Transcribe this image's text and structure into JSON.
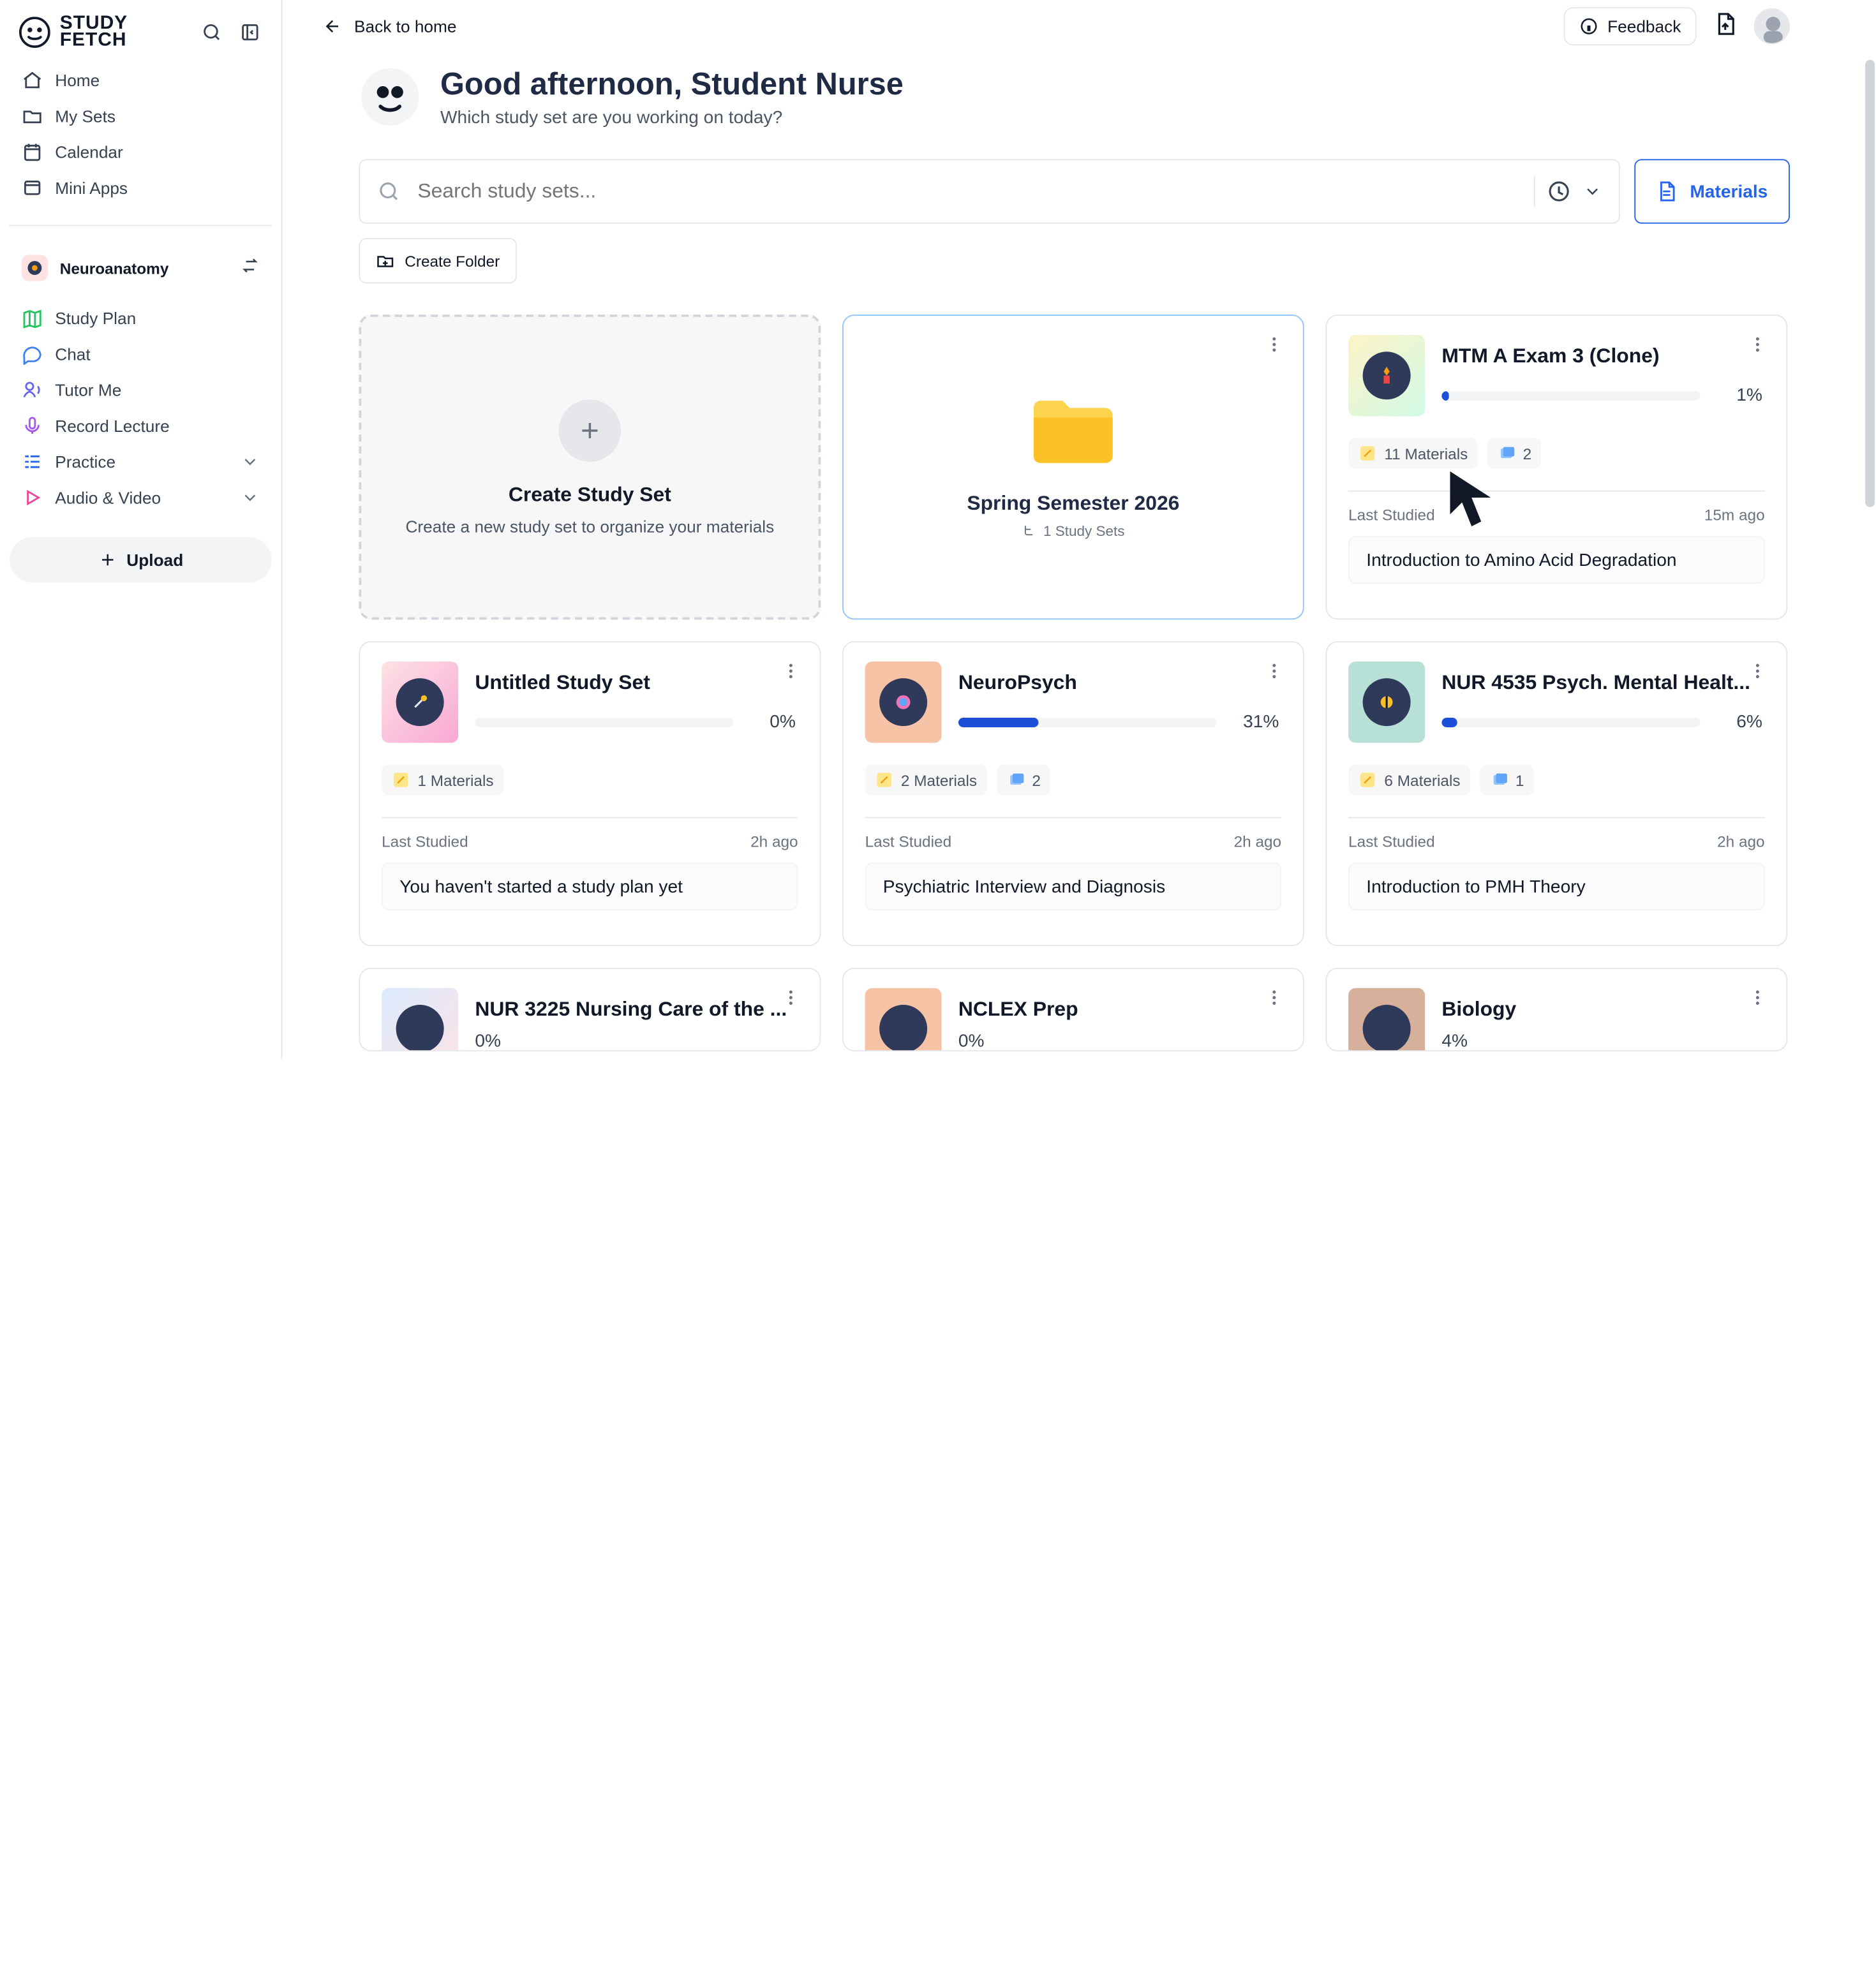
{
  "sidebar": {
    "brand_line1": "STUDY",
    "brand_line2": "FETCH",
    "nav": [
      {
        "label": "Home",
        "icon": "home-icon"
      },
      {
        "label": "My Sets",
        "icon": "folder-icon"
      },
      {
        "label": "Calendar",
        "icon": "calendar-icon"
      },
      {
        "label": "Mini Apps",
        "icon": "mini-apps-icon"
      }
    ],
    "subject": {
      "name": "Neuroanatomy"
    },
    "study_nav": [
      {
        "label": "Study Plan",
        "icon": "map-icon"
      },
      {
        "label": "Chat",
        "icon": "chat-icon"
      },
      {
        "label": "Tutor Me",
        "icon": "tutor-icon"
      },
      {
        "label": "Record Lecture",
        "icon": "mic-icon"
      },
      {
        "label": "Practice",
        "icon": "practice-icon"
      },
      {
        "label": "Audio & Video",
        "icon": "play-icon"
      }
    ],
    "upload_label": "Upload"
  },
  "topbar": {
    "back_label": "Back to home",
    "feedback_label": "Feedback"
  },
  "greeting": {
    "title": "Good afternoon, Student Nurse",
    "subtitle": "Which study set are you working on today?"
  },
  "search": {
    "placeholder": "Search study sets...",
    "materials_label": "Materials"
  },
  "create_folder_label": "Create Folder",
  "create_set": {
    "title": "Create Study Set",
    "subtitle": "Create a new study set to organize your materials"
  },
  "folder": {
    "title": "Spring Semester 2026",
    "meta": "1 Study Sets"
  },
  "cards": [
    {
      "title": "MTM A Exam 3 (Clone)",
      "progress": 1,
      "progress_label": "1%",
      "materials": "11 Materials",
      "flashcards": "2",
      "last_label": "Last Studied",
      "last_time": "15m ago",
      "last_item": "Introduction to Amino Acid Degradation"
    },
    {
      "title": "Untitled Study Set",
      "progress": 0,
      "progress_label": "0%",
      "materials": "1 Materials",
      "flashcards": "",
      "last_label": "Last Studied",
      "last_time": "2h ago",
      "last_item": "You haven't started a study plan yet"
    },
    {
      "title": "NeuroPsych",
      "progress": 31,
      "progress_label": "31%",
      "materials": "2 Materials",
      "flashcards": "2",
      "last_label": "Last Studied",
      "last_time": "2h ago",
      "last_item": "Psychiatric Interview and Diagnosis"
    },
    {
      "title": "NUR 4535 Psych. Mental Healt...",
      "progress": 6,
      "progress_label": "6%",
      "materials": "6 Materials",
      "flashcards": "1",
      "last_label": "Last Studied",
      "last_time": "2h ago",
      "last_item": "Introduction to PMH Theory"
    }
  ],
  "partials": [
    {
      "title": "NUR 3225 Nursing Care of the ...",
      "progress_label": "0%"
    },
    {
      "title": "NCLEX Prep",
      "progress_label": "0%"
    },
    {
      "title": "Biology",
      "progress_label": "4%"
    }
  ]
}
